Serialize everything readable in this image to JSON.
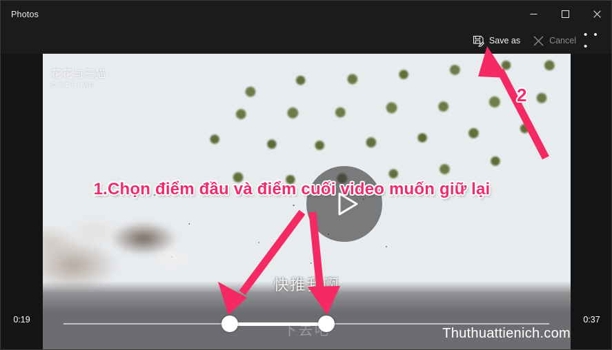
{
  "window": {
    "app_title": "Photos",
    "controls": [
      {
        "name": "minimize-button",
        "icon": "minimize-icon",
        "label": "Minimize"
      },
      {
        "name": "maximize-button",
        "icon": "maximize-icon",
        "label": "Maximize"
      },
      {
        "name": "close-button",
        "icon": "close-icon",
        "label": "Close"
      }
    ]
  },
  "command_bar": {
    "save_as": {
      "label": "Save as",
      "icon": "save-as-icon",
      "enabled": true
    },
    "cancel": {
      "label": "Cancel",
      "icon": "close-x-icon",
      "enabled": false
    },
    "more": {
      "label": "• • •",
      "icon": "more-options-icon"
    }
  },
  "player": {
    "current_time": "0:19",
    "end_time": "0:37",
    "play_button_icon": "play-triangle-icon",
    "trim": {
      "start_handle_label": "Trim start handle",
      "end_handle_label": "Trim end handle",
      "start_pct": 34.2,
      "end_pct": 54.1
    }
  },
  "video": {
    "channel_watermark_cn": "花花与三猫",
    "channel_watermark_en": "CATLIVE",
    "subtitle": "快推我啊",
    "subtitle_secondary": "下去吧"
  },
  "annotations": {
    "step_one_text": "1.Chọn điểm đầu và điểm cuối video muốn giữ lại",
    "step_two_label": "2",
    "arrow_color": "#f52a63",
    "text_color": "#ef2d6b",
    "outline_color": "#ffffff"
  },
  "page_watermark": "Thuthuattienich.com"
}
